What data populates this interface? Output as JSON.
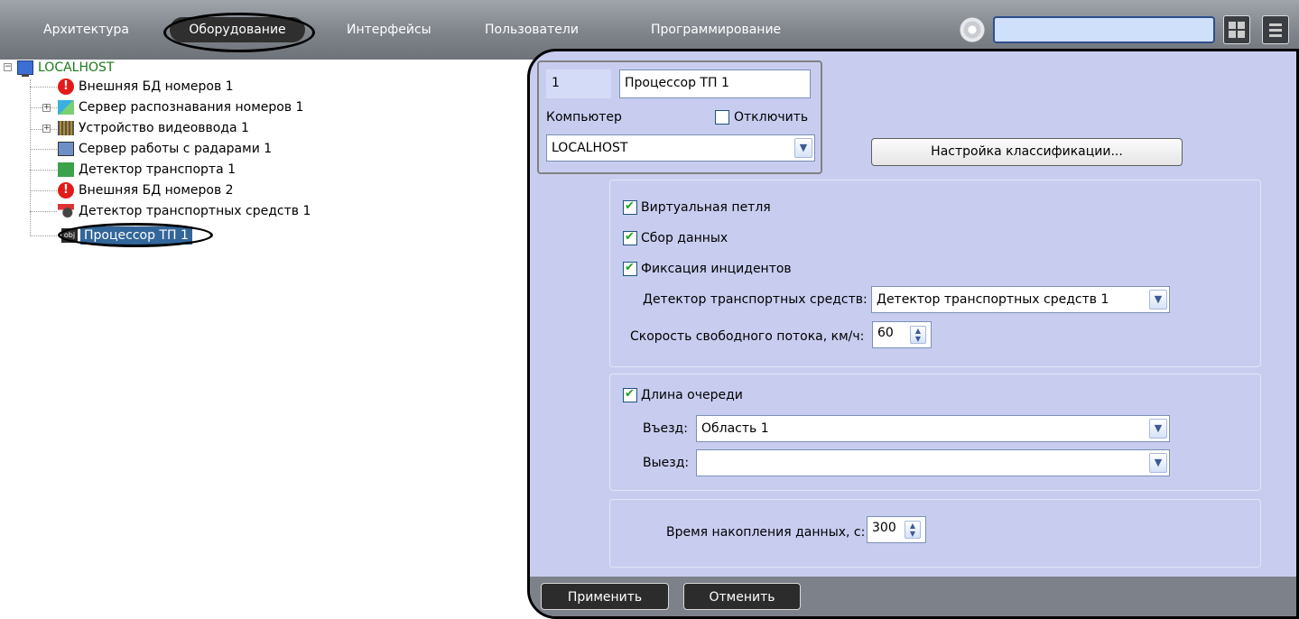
{
  "top_tabs": {
    "architecture": "Архитектура",
    "hardware": "Оборудование",
    "interfaces": "Интерфейсы",
    "users": "Пользователи",
    "programming": "Программирование"
  },
  "tree": {
    "root": "LOCALHOST",
    "items": [
      {
        "label": "Внешняя БД номеров 1",
        "icon": "alert-icon"
      },
      {
        "label": "Сервер распознавания номеров 1",
        "icon": "lpr-server-icon"
      },
      {
        "label": "Устройство видеоввода 1",
        "icon": "video-device-icon"
      },
      {
        "label": "Сервер работы с радарами 1",
        "icon": "radar-server-icon"
      },
      {
        "label": "Детектор транспорта 1",
        "icon": "transport-detector-icon"
      },
      {
        "label": "Внешняя БД номеров 2",
        "icon": "alert-icon"
      },
      {
        "label": "Детектор транспортных средств 1",
        "icon": "vehicle-detector-icon"
      },
      {
        "label": "Процессор ТП 1",
        "icon": "processor-icon",
        "selected": true
      }
    ]
  },
  "settings": {
    "id_value": "1",
    "name_value": "Процессор ТП 1",
    "computer_label": "Компьютер",
    "disable_label": "Отключить",
    "disable_checked": false,
    "computer_value": "LOCALHOST",
    "classify_button": "Настройка классификации...",
    "virtual_loop_label": "Виртуальная петля",
    "virtual_loop_checked": true,
    "data_collection_label": "Сбор данных",
    "data_collection_checked": true,
    "incident_label": "Фиксация инцидентов",
    "incident_checked": true,
    "vehicle_detector_label": "Детектор транспортных средств:",
    "vehicle_detector_value": "Детектор транспортных средств 1",
    "free_speed_label": "Скорость свободного потока, км/ч:",
    "free_speed_value": "60",
    "queue_label": "Длина очереди",
    "queue_checked": true,
    "entry_label": "Въезд:",
    "entry_value": "Область 1",
    "exit_label": "Выезд:",
    "exit_value": "",
    "accum_label": "Время накопления данных, с:",
    "accum_value": "300"
  },
  "footer": {
    "apply": "Применить",
    "cancel": "Отменить"
  },
  "colors": {
    "panel_bg": "#c8cdf0",
    "selection": "#33669a",
    "topbar": "#858a91"
  }
}
